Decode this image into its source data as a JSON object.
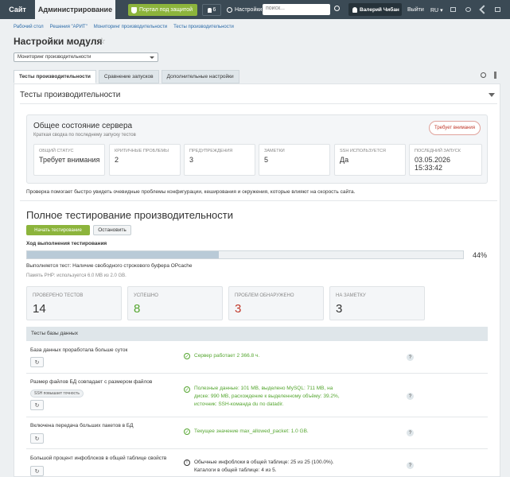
{
  "topbar": {
    "site_tab": "Сайт",
    "admin_tab": "Администрирование",
    "portal_button": "Портал под защитой",
    "notifications_count": "6",
    "settings_link": "Настройки",
    "search_placeholder": "поиск...",
    "user_name": "Валерий Чибан",
    "exit_link": "Выйти",
    "lang": "RU"
  },
  "breadcrumbs": [
    "Рабочий стол",
    "Решения \"АРИТ\"",
    "Мониторинг производительности",
    "Тесты производительности"
  ],
  "page_title": "Настройки модуля",
  "module_select": "Мониторинг производительности",
  "tabs": [
    {
      "label": "Тесты производительности",
      "active": true
    },
    {
      "label": "Сравнение запусков",
      "active": false
    },
    {
      "label": "Дополнительные настройки",
      "active": false
    }
  ],
  "panel_title": "Тесты производительности",
  "server_status": {
    "title": "Общее состояние сервера",
    "subtitle": "Краткая сводка по последнему запуску тестов",
    "badge": "Требует внимания",
    "stats": [
      {
        "label": "Общий статус",
        "value": "Требует внимания"
      },
      {
        "label": "Критичные проблемы",
        "value": "2"
      },
      {
        "label": "Предупреждения",
        "value": "3"
      },
      {
        "label": "Заметки",
        "value": "5"
      },
      {
        "label": "SSH используется",
        "value": "Да"
      },
      {
        "label": "Последний запуск",
        "value": "03.05.2026 15:33:42"
      }
    ]
  },
  "hint": "Проверка помогает быстро увидеть очевидные проблемы конфигурации, кеширования и окружения, которые влияют на скорость сайта.",
  "full_test": {
    "title": "Полное тестирование производительности",
    "start_button": "Начать тестирование",
    "stop_button": "Остановить",
    "progress_label": "Ход выполнения тестирования",
    "progress_percent": 44,
    "progress_text": "44%",
    "current_test": "Выполняется тест: Наличие свободного строкового буфера OPcache",
    "php_memory": "Память PHP: используется 6.0 MB из 2.0 GB.",
    "counts": [
      {
        "label": "Проверено тестов",
        "value": "14",
        "color": "#333333"
      },
      {
        "label": "Успешно",
        "value": "8",
        "color": "#55a630"
      },
      {
        "label": "Проблем обнаружено",
        "value": "3",
        "color": "#c0392b"
      },
      {
        "label": "На заметку",
        "value": "3",
        "color": "#333333"
      }
    ]
  },
  "db_tests": {
    "header": "Тесты базы данных",
    "rows": [
      {
        "name": "База данных проработала больше суток",
        "tag": "",
        "status": "ok",
        "result": "Сервер работает 2 366.8 ч."
      },
      {
        "name": "Размер файлов БД совпадает с размером файлов",
        "tag": "SSH повышает точность",
        "status": "ok",
        "result": "Полезные данные: 101 MB, выделено MySQL: 711 MB, на диске: 990 MB, расхождение к выделенному объёму: 39.2%, источник: SSH-команда du по datadir."
      },
      {
        "name": "Включена передача больших пакетов в БД",
        "tag": "",
        "status": "ok",
        "result": "Текущее значение max_allowed_packet: 1.0 GB."
      },
      {
        "name": "Большой процент инфоблоков в общей таблице свойств",
        "tag": "",
        "status": "warn",
        "result": "Обычные инфоблоки в общей таблице: 25 из 25 (100.0%). Каталоги в общей таблице: 4 из 5."
      }
    ]
  },
  "colors": {
    "accent_green": "#8cb43c",
    "topbar": "#3b4a55",
    "ok": "#55a630",
    "error": "#c0392b"
  }
}
